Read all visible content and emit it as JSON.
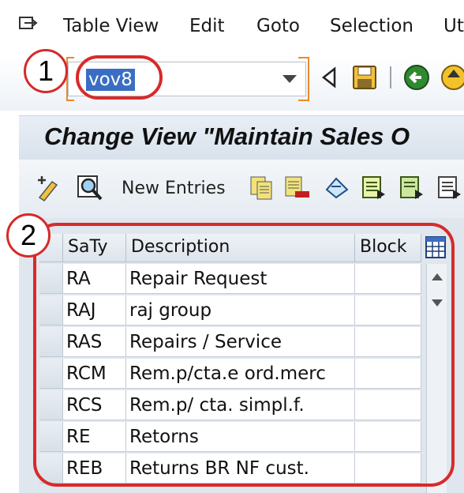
{
  "menu": {
    "items": [
      "Table View",
      "Edit",
      "Goto",
      "Selection",
      "Ut"
    ]
  },
  "command_field": {
    "value": "vov8"
  },
  "callouts": [
    "1",
    "2"
  ],
  "title": "Change View \"Maintain Sales O",
  "toolbar": {
    "new_entries_label": "New Entries"
  },
  "table": {
    "columns": [
      "SaTy",
      "Description",
      "Block"
    ],
    "rows": [
      {
        "saty": "RA",
        "description": "Repair Request",
        "block": ""
      },
      {
        "saty": "RAJ",
        "description": "raj group",
        "block": ""
      },
      {
        "saty": "RAS",
        "description": "Repairs / Service",
        "block": ""
      },
      {
        "saty": "RCM",
        "description": "Rem.p/cta.e ord.merc",
        "block": ""
      },
      {
        "saty": "RCS",
        "description": "Rem.p/ cta. simpl.f.",
        "block": ""
      },
      {
        "saty": "RE",
        "description": "Retorns",
        "block": ""
      },
      {
        "saty": "REB",
        "description": "Returns BR NF cust.",
        "block": ""
      }
    ]
  },
  "colors": {
    "callout_red": "#d82a2a",
    "selection_blue": "#3a6ec4",
    "bracket_orange": "#e88a2e"
  }
}
